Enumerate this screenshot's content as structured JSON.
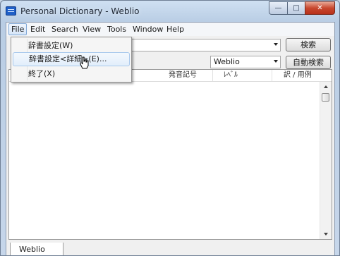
{
  "window": {
    "title": "Personal Dictionary - Weblio",
    "min_glyph": "—",
    "max_glyph": "□",
    "close_glyph": "✕"
  },
  "menubar": {
    "items": [
      {
        "label": "File",
        "active": true
      },
      {
        "label": "Edit"
      },
      {
        "label": "Search"
      },
      {
        "label": "View"
      },
      {
        "label": "Tools"
      },
      {
        "label": "Window"
      },
      {
        "label": "Help"
      }
    ]
  },
  "file_menu": {
    "items": [
      {
        "label": "辞書設定(W)"
      },
      {
        "label": "辞書設定<詳細>(E)...",
        "hovered": true
      },
      {
        "label": "終了(X)"
      }
    ]
  },
  "toolbar": {
    "search_value": "",
    "search_button": "検索",
    "dictionary_selected": "Weblio",
    "auto_search_button": "自動検索"
  },
  "list": {
    "columns": [
      "発音記号",
      "ﾚﾍﾞﾙ",
      "訳 / 用例"
    ],
    "rows": []
  },
  "tabs": [
    {
      "label": "Weblio",
      "active": true
    }
  ]
}
